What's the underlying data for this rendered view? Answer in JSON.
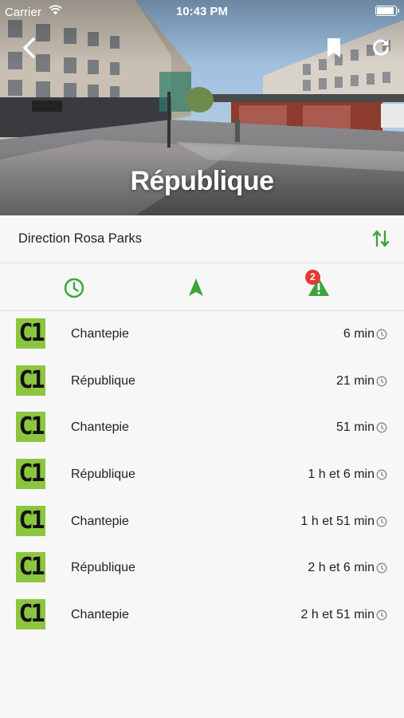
{
  "status_bar": {
    "carrier": "Carrier",
    "time": "10:43 PM"
  },
  "header": {
    "stop_name": "République",
    "back_icon": "chevron-left-icon",
    "bookmark_icon": "bookmark-icon",
    "refresh_icon": "refresh-icon"
  },
  "direction": {
    "label": "Direction Rosa Parks",
    "swap_icon": "swap-vertical-icon"
  },
  "tabs": [
    {
      "id": "schedule",
      "icon": "clock-icon"
    },
    {
      "id": "map",
      "icon": "navigation-arrow-icon"
    },
    {
      "id": "alerts",
      "icon": "warning-icon",
      "badge": "2"
    }
  ],
  "colors": {
    "accent_green": "#3ca33c",
    "line_c1": "#8cc63f",
    "badge_red": "#e53935"
  },
  "departures": [
    {
      "line": "C1",
      "destination": "Chantepie",
      "wait": "6 min"
    },
    {
      "line": "C1",
      "destination": "République",
      "wait": "21 min"
    },
    {
      "line": "C1",
      "destination": "Chantepie",
      "wait": "51 min"
    },
    {
      "line": "C1",
      "destination": "République",
      "wait": "1 h et 6 min"
    },
    {
      "line": "C1",
      "destination": "Chantepie",
      "wait": "1 h et 51 min"
    },
    {
      "line": "C1",
      "destination": "République",
      "wait": "2 h et 6 min"
    },
    {
      "line": "C1",
      "destination": "Chantepie",
      "wait": "2 h et 51 min"
    }
  ]
}
